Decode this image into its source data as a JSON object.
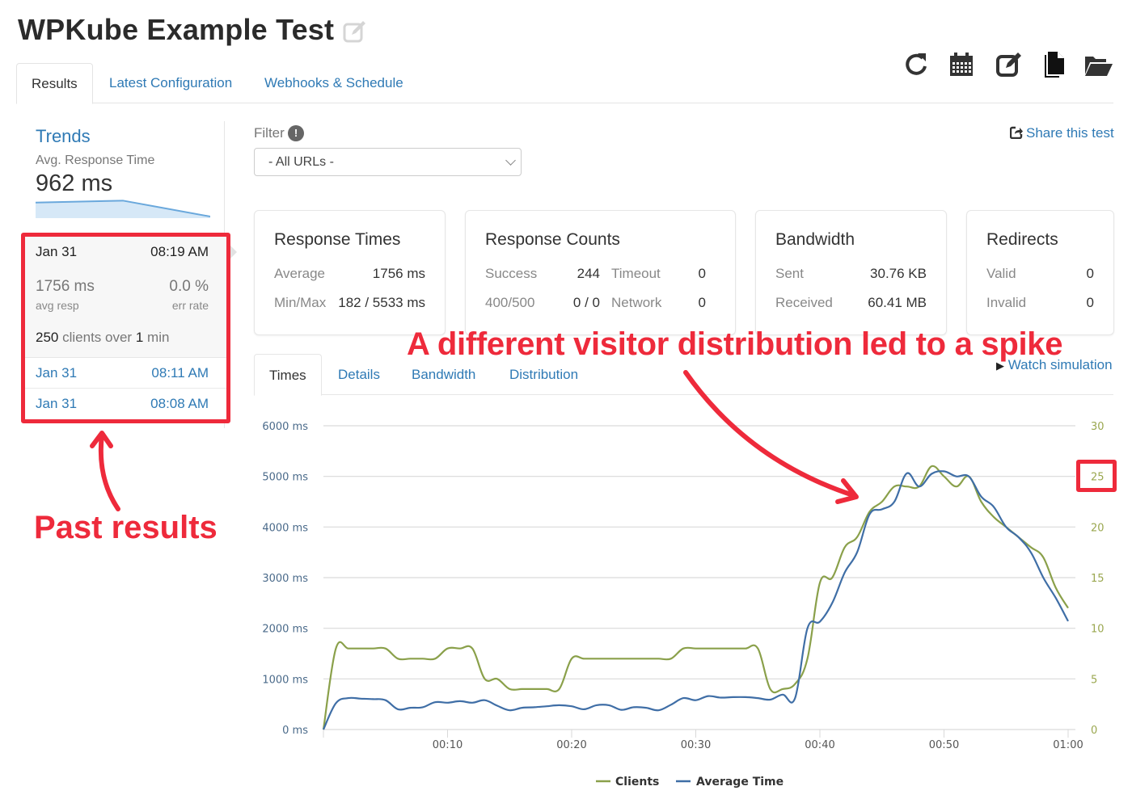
{
  "header": {
    "title": "WPKube Example Test",
    "title_edit_icon": "edit-icon",
    "tabs": [
      {
        "label": "Results",
        "active": true
      },
      {
        "label": "Latest Configuration",
        "active": false
      },
      {
        "label": "Webhooks & Schedule",
        "active": false
      }
    ],
    "toolbar_icons": [
      "refresh-icon",
      "calendar-icon",
      "edit-icon",
      "copy-icon",
      "folder-open-icon"
    ]
  },
  "sidebar": {
    "trends_title": "Trends",
    "trend_label": "Avg. Response Time",
    "trend_value": "962 ms",
    "sparkline": [
      0.72,
      0.82,
      0.0
    ],
    "runs": [
      {
        "date": "Jan 31",
        "time": "08:19 AM",
        "active": true,
        "avg_resp": "1756 ms",
        "avg_resp_label": "avg resp",
        "err_rate": "0.0 %",
        "err_rate_label": "err rate",
        "clients": "250",
        "clients_text": "clients over",
        "duration": "1",
        "duration_unit": "min"
      },
      {
        "date": "Jan 31",
        "time": "08:11 AM",
        "active": false
      },
      {
        "date": "Jan 31",
        "time": "08:08 AM",
        "active": false
      }
    ]
  },
  "filter": {
    "label": "Filter",
    "info_icon": "!",
    "selected": "- All URLs -"
  },
  "share": {
    "label": "Share this test",
    "icon": "share-icon"
  },
  "cards": {
    "response_times": {
      "title": "Response Times",
      "rows": [
        {
          "label": "Average",
          "value": "1756 ms"
        },
        {
          "label": "Min/Max",
          "value": "182 / 5533 ms"
        }
      ]
    },
    "response_counts": {
      "title": "Response Counts",
      "rows": [
        {
          "label": "Success",
          "value": "244",
          "label2": "Timeout",
          "value2": "0"
        },
        {
          "label": "400/500",
          "value": "0 / 0",
          "label2": "Network",
          "value2": "0"
        }
      ]
    },
    "bandwidth": {
      "title": "Bandwidth",
      "rows": [
        {
          "label": "Sent",
          "value": "30.76 KB"
        },
        {
          "label": "Received",
          "value": "60.41 MB"
        }
      ]
    },
    "redirects": {
      "title": "Redirects",
      "rows": [
        {
          "label": "Valid",
          "value": "0"
        },
        {
          "label": "Invalid",
          "value": "0"
        }
      ]
    }
  },
  "subtabs": [
    {
      "label": "Times",
      "active": true
    },
    {
      "label": "Details",
      "active": false
    },
    {
      "label": "Bandwidth",
      "active": false
    },
    {
      "label": "Distribution",
      "active": false
    }
  ],
  "watch_simulation": "Watch simulation",
  "annotations": {
    "spike": "A different visitor distribution led to a spike",
    "past_results": "Past results",
    "color": "#ee2a3b"
  },
  "colors": {
    "link": "#2f7ab5",
    "clients": "#8aa04a",
    "average_time": "#3f6ea6",
    "grid": "#d9d9d9",
    "left_axis_text": "#4a6a8a",
    "right_axis_text": "#9aa74f"
  },
  "chart_data": {
    "type": "line",
    "title": "",
    "xlabel": "",
    "ylabel": "",
    "x_unit": "seconds",
    "x_range": [
      0,
      60
    ],
    "x_ticks": [
      {
        "value": 10,
        "label": "00:10"
      },
      {
        "value": 20,
        "label": "00:20"
      },
      {
        "value": 30,
        "label": "00:30"
      },
      {
        "value": 40,
        "label": "00:40"
      },
      {
        "value": 50,
        "label": "00:50"
      },
      {
        "value": 60,
        "label": "01:00"
      }
    ],
    "y_left": {
      "range": [
        0,
        6000
      ],
      "ticks": [
        "0 ms",
        "1000 ms",
        "2000 ms",
        "3000 ms",
        "4000 ms",
        "5000 ms",
        "6000 ms"
      ]
    },
    "y_right": {
      "range": [
        0,
        30
      ],
      "ticks": [
        "0",
        "5",
        "10",
        "15",
        "20",
        "25",
        "30"
      ],
      "highlighted_tick": "25"
    },
    "grid": true,
    "legend_position": "bottom-center",
    "x": [
      0,
      1,
      2,
      3,
      4,
      5,
      6,
      7,
      8,
      9,
      10,
      11,
      12,
      13,
      14,
      15,
      16,
      17,
      18,
      19,
      20,
      21,
      22,
      23,
      24,
      25,
      26,
      27,
      28,
      29,
      30,
      31,
      32,
      33,
      34,
      35,
      36,
      37,
      38,
      39,
      40,
      41,
      42,
      43,
      44,
      45,
      46,
      47,
      48,
      49,
      50,
      51,
      52,
      53,
      54,
      55,
      56,
      57,
      58,
      59,
      60
    ],
    "series": [
      {
        "name": "Clients",
        "axis": "right",
        "values": [
          0,
          8,
          8,
          8,
          8,
          8,
          7,
          7,
          7,
          7,
          8,
          8,
          8,
          5,
          5,
          4,
          4,
          4,
          4,
          4,
          7,
          7,
          7,
          7,
          7,
          7,
          7,
          7,
          7,
          8,
          8,
          8,
          8,
          8,
          8,
          8,
          4,
          4,
          4.5,
          7,
          14.5,
          15,
          18,
          19,
          21.5,
          22.5,
          24,
          24,
          24,
          26,
          25,
          24,
          25,
          22.5,
          21,
          20,
          19,
          18,
          17,
          14,
          12
        ]
      },
      {
        "name": "Average Time",
        "axis": "left",
        "values": [
          0,
          520,
          620,
          610,
          600,
          580,
          400,
          430,
          440,
          540,
          530,
          560,
          530,
          580,
          470,
          380,
          430,
          440,
          460,
          480,
          460,
          400,
          480,
          480,
          390,
          440,
          430,
          380,
          490,
          620,
          580,
          660,
          630,
          640,
          640,
          620,
          590,
          690,
          620,
          2000,
          2130,
          2500,
          3100,
          3500,
          4250,
          4350,
          4500,
          5060,
          4800,
          5050,
          5100,
          5000,
          5000,
          4600,
          4400,
          4000,
          3800,
          3500,
          3000,
          2600,
          2140
        ]
      }
    ]
  }
}
